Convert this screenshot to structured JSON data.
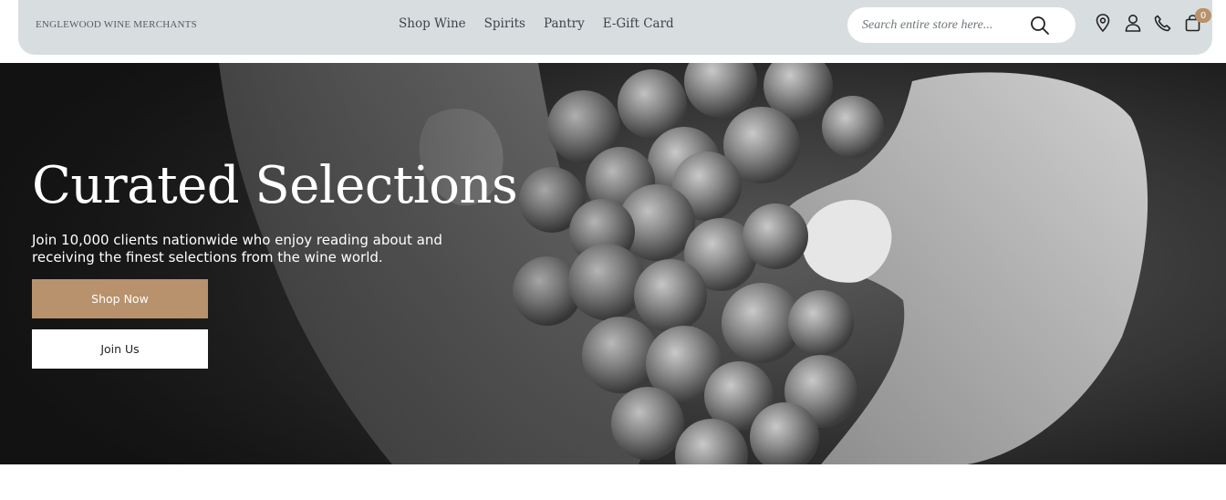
{
  "header": {
    "brand": "ENGLEWOOD WINE MERCHANTS",
    "nav": [
      "Shop Wine",
      "Spirits",
      "Pantry",
      "E-Gift Card"
    ],
    "search": {
      "placeholder": "Search entire store here...",
      "icon": "search-icon"
    },
    "icons": [
      "location-pin-icon",
      "user-icon",
      "phone-icon",
      "cart-icon"
    ],
    "cart_count": "0"
  },
  "hero": {
    "title": "Curated Selections",
    "subtitle": "Join 10,000 clients nationwide who enjoy reading about and receiving the finest selections from the wine world.",
    "primary_button": "Shop Now",
    "secondary_button": "Join Us"
  },
  "colors": {
    "header_bg": "#d8dde0",
    "accent": "#b8926c",
    "text_dark": "#3d4448"
  }
}
